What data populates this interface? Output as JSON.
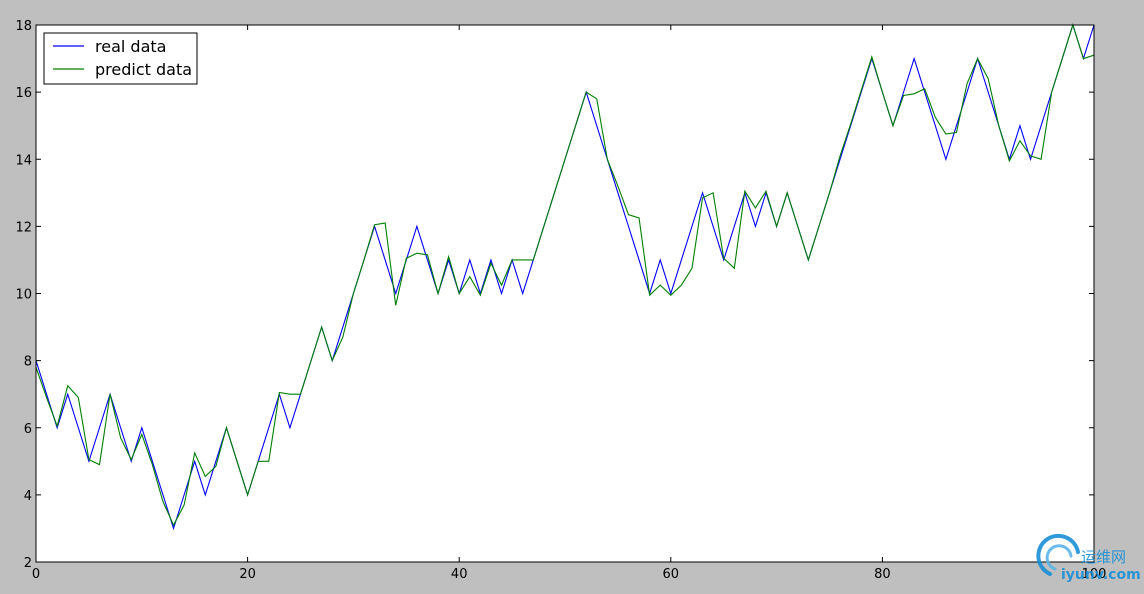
{
  "chart_data": {
    "type": "line",
    "title": "",
    "xlabel": "",
    "ylabel": "",
    "xlim": [
      0,
      100
    ],
    "ylim": [
      2,
      18
    ],
    "xticks": [
      0,
      20,
      40,
      60,
      80,
      100
    ],
    "yticks": [
      2,
      4,
      6,
      8,
      10,
      12,
      14,
      16,
      18
    ],
    "grid": false,
    "legend_position": "top-left",
    "series": [
      {
        "name": "real data",
        "color": "#0000ff",
        "x": [
          0,
          1,
          2,
          3,
          4,
          5,
          6,
          7,
          8,
          9,
          10,
          11,
          12,
          13,
          14,
          15,
          16,
          17,
          18,
          19,
          20,
          21,
          22,
          23,
          24,
          25,
          26,
          27,
          28,
          29,
          30,
          31,
          32,
          33,
          34,
          35,
          36,
          37,
          38,
          39,
          40,
          41,
          42,
          43,
          44,
          45,
          46,
          47,
          48,
          49,
          50,
          51,
          52,
          53,
          54,
          55,
          56,
          57,
          58,
          59,
          60,
          61,
          62,
          63,
          64,
          65,
          66,
          67,
          68,
          69,
          70,
          71,
          72,
          73,
          74,
          75,
          76,
          77,
          78,
          79,
          80,
          81,
          82,
          83,
          84,
          85,
          86,
          87,
          88,
          89,
          90,
          91,
          92,
          93,
          94,
          95,
          96,
          97,
          98,
          99,
          100
        ],
        "values": [
          8,
          7,
          6,
          7,
          6,
          5,
          6,
          7,
          6,
          5,
          6,
          5,
          4,
          3,
          4,
          5,
          4,
          5,
          6,
          5,
          4,
          5,
          6,
          7,
          6,
          7,
          8,
          9,
          8,
          9,
          10,
          11,
          12,
          11,
          10,
          11,
          12,
          11,
          10,
          11,
          10,
          11,
          10,
          11,
          10,
          11,
          10,
          11,
          12,
          13,
          14,
          15,
          16,
          15,
          14,
          13,
          12,
          11,
          10,
          11,
          10,
          11,
          12,
          13,
          12,
          11,
          12,
          13,
          12,
          13,
          12,
          13,
          12,
          11,
          12,
          13,
          14,
          15,
          16,
          17,
          16,
          15,
          16,
          17,
          16,
          15,
          14,
          15,
          16,
          17,
          16,
          15,
          14,
          15,
          14,
          15,
          16,
          17,
          18,
          17,
          18
        ]
      },
      {
        "name": "predict data",
        "color": "#008000",
        "x": [
          0,
          1,
          2,
          3,
          4,
          5,
          6,
          7,
          8,
          9,
          10,
          11,
          12,
          13,
          14,
          15,
          16,
          17,
          18,
          19,
          20,
          21,
          22,
          23,
          24,
          25,
          26,
          27,
          28,
          29,
          30,
          31,
          32,
          33,
          34,
          35,
          36,
          37,
          38,
          39,
          40,
          41,
          42,
          43,
          44,
          45,
          46,
          47,
          48,
          49,
          50,
          51,
          52,
          53,
          54,
          55,
          56,
          57,
          58,
          59,
          60,
          61,
          62,
          63,
          64,
          65,
          66,
          67,
          68,
          69,
          70,
          71,
          72,
          73,
          74,
          75,
          76,
          77,
          78,
          79,
          80,
          81,
          82,
          83,
          84,
          85,
          86,
          87,
          88,
          89,
          90,
          91,
          92,
          93,
          94,
          95,
          96,
          97,
          98,
          99,
          100
        ],
        "values": [
          7.8,
          6.9,
          6.05,
          7.25,
          6.9,
          5.05,
          4.9,
          7.0,
          5.7,
          5.05,
          5.8,
          4.9,
          3.8,
          3.1,
          3.7,
          5.25,
          4.55,
          4.85,
          6.0,
          5.0,
          4.0,
          5.0,
          5.0,
          7.05,
          7.0,
          7.0,
          8.0,
          9.0,
          8.0,
          8.7,
          10.0,
          11.0,
          12.05,
          12.1,
          9.65,
          11.05,
          11.2,
          11.15,
          10.0,
          11.1,
          10.0,
          10.5,
          9.95,
          10.9,
          10.25,
          11.0,
          11.0,
          11.0,
          12.0,
          13.0,
          14.0,
          15.0,
          16.0,
          15.8,
          14.0,
          13.2,
          12.35,
          12.25,
          9.95,
          10.25,
          9.95,
          10.25,
          10.75,
          12.85,
          13.0,
          11.05,
          10.75,
          13.05,
          12.55,
          13.05,
          12.0,
          13.0,
          12.0,
          11.0,
          12.0,
          13.0,
          14.1,
          15.05,
          16.05,
          17.05,
          16.0,
          15.0,
          15.9,
          15.95,
          16.1,
          15.25,
          14.75,
          14.8,
          16.25,
          17.0,
          16.4,
          15.0,
          13.95,
          14.55,
          14.1,
          14.0,
          16.0,
          17.0,
          18.0,
          17.0,
          17.1
        ]
      }
    ]
  },
  "watermark": {
    "cn_text": "运维网",
    "en_text": "iyunv.com",
    "color": "#1a8fd6"
  }
}
